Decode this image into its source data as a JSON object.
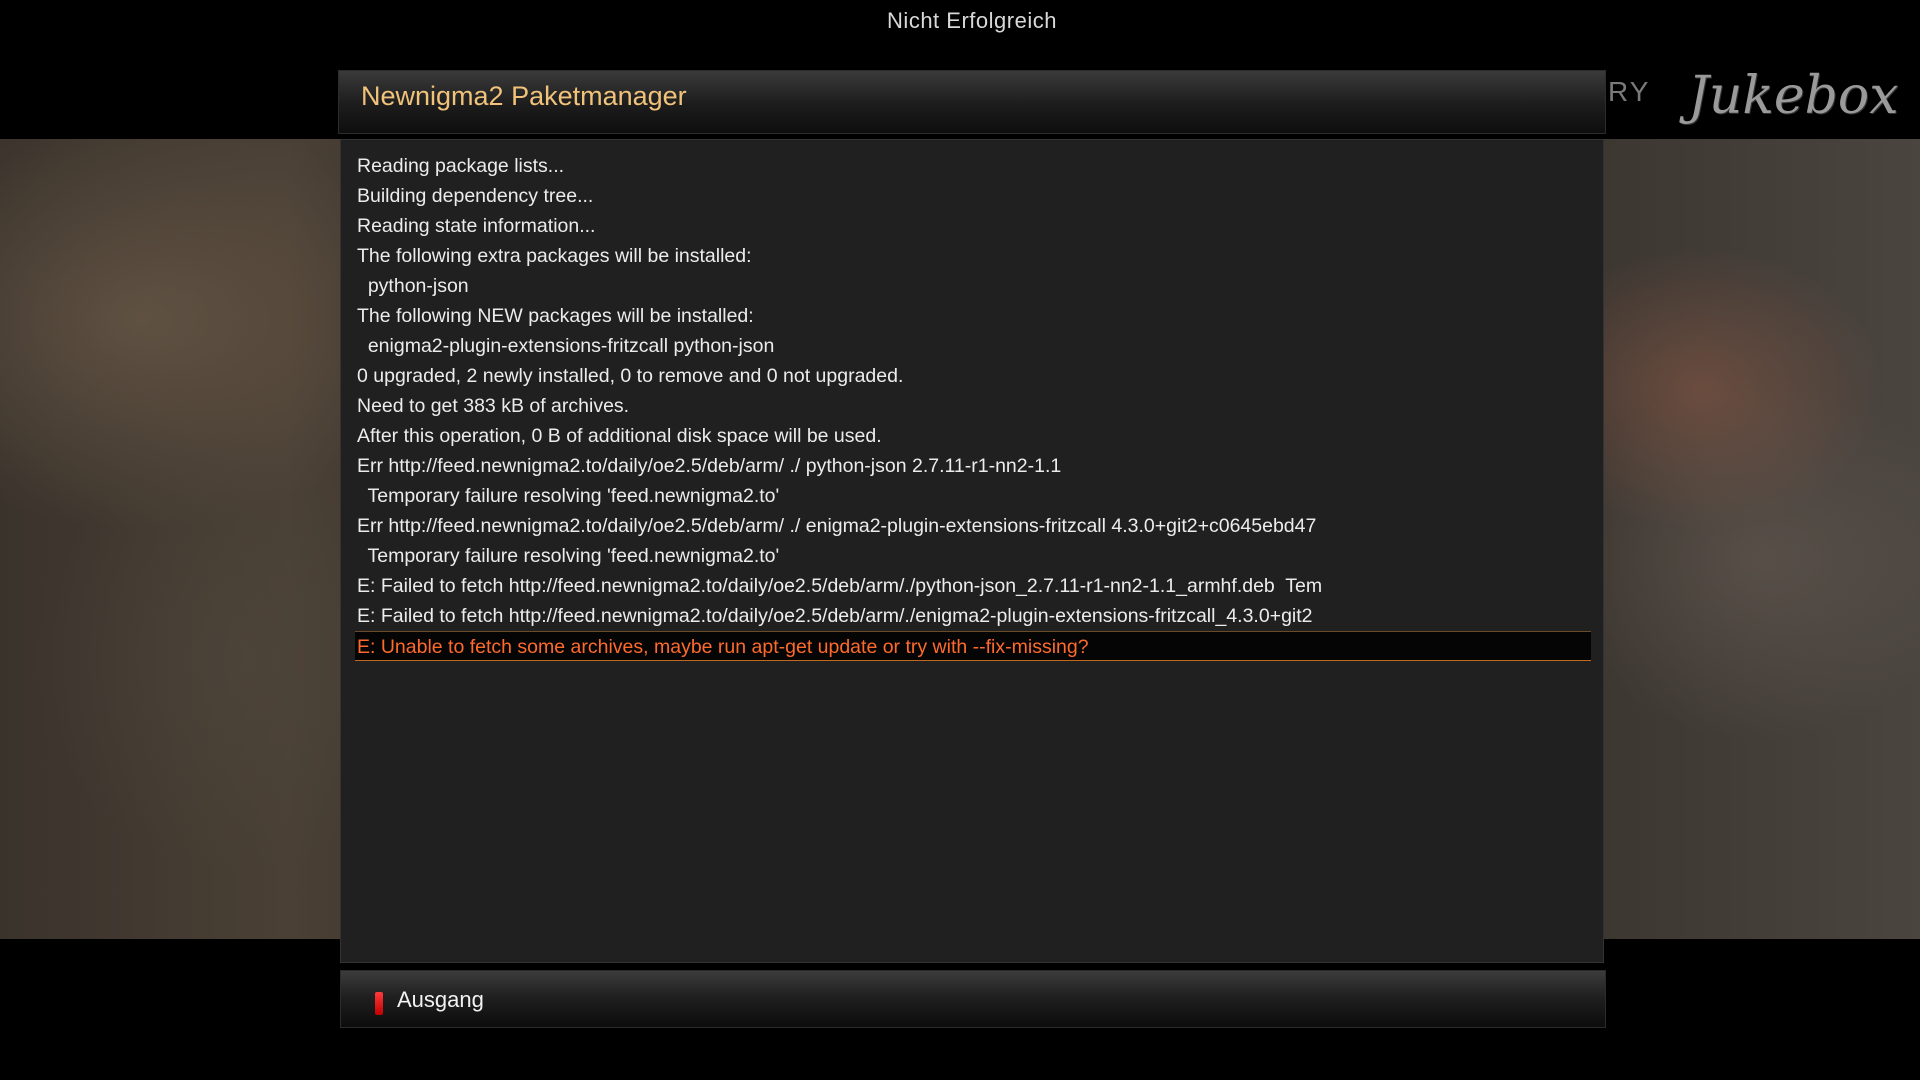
{
  "screen": {
    "top_title": "Nicht Erfolgreich",
    "brand_partial": "RY",
    "brand_logo": "Jukebox"
  },
  "dialog": {
    "title": "Newnigma2 Paketmanager",
    "log_lines": [
      "Reading package lists...",
      "Building dependency tree...",
      "Reading state information...",
      "The following extra packages will be installed:",
      "  python-json",
      "The following NEW packages will be installed:",
      "  enigma2-plugin-extensions-fritzcall python-json",
      "0 upgraded, 2 newly installed, 0 to remove and 0 not upgraded.",
      "Need to get 383 kB of archives.",
      "After this operation, 0 B of additional disk space will be used.",
      "Err http://feed.newnigma2.to/daily/oe2.5/deb/arm/ ./ python-json 2.7.11-r1-nn2-1.1",
      "  Temporary failure resolving 'feed.newnigma2.to'",
      "Err http://feed.newnigma2.to/daily/oe2.5/deb/arm/ ./ enigma2-plugin-extensions-fritzcall 4.3.0+git2+c0645ebd47",
      "  Temporary failure resolving 'feed.newnigma2.to'",
      "E: Failed to fetch http://feed.newnigma2.to/daily/oe2.5/deb/arm/./python-json_2.7.11-r1-nn2-1.1_armhf.deb  Tem",
      "E: Failed to fetch http://feed.newnigma2.to/daily/oe2.5/deb/arm/./enigma2-plugin-extensions-fritzcall_4.3.0+git2",
      "E: Unable to fetch some archives, maybe run apt-get update or try with --fix-missing?"
    ],
    "selected_index": 16
  },
  "buttons": {
    "exit_label": "Ausgang",
    "exit_key_color": "#e01010"
  },
  "colors": {
    "title_accent": "#f0c27a",
    "selected_text": "#ff6a2c",
    "selection_border": "#c0681e",
    "log_text": "#ececec",
    "panel_bg": "#202020"
  }
}
